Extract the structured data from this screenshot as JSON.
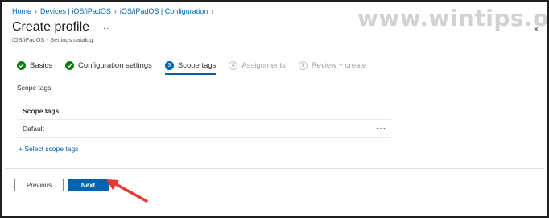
{
  "breadcrumb": {
    "items": [
      "Home",
      "Devices | iOS/iPadOS",
      "iOS/iPadOS | Configuration"
    ]
  },
  "header": {
    "title": "Create profile",
    "more_label": "...",
    "subtitle": "iOS/iPadOS - Settings catalog",
    "close_label": "×"
  },
  "watermark": {
    "text": "www.wintips.org"
  },
  "wizard": {
    "steps": [
      {
        "label": "Basics",
        "state": "done",
        "marker": "✓"
      },
      {
        "label": "Configuration settings",
        "state": "done",
        "marker": "✓"
      },
      {
        "label": "Scope tags",
        "state": "active",
        "marker": "3"
      },
      {
        "label": "Assignments",
        "state": "disabled",
        "marker": "4"
      },
      {
        "label": "Review + create",
        "state": "disabled",
        "marker": "5"
      }
    ]
  },
  "main": {
    "section_label": "Scope tags",
    "table": {
      "header": "Scope tags",
      "rows": [
        {
          "name": "Default",
          "more_label": "···"
        }
      ]
    },
    "select_link": "+ Select scope tags"
  },
  "footer": {
    "previous_label": "Previous",
    "next_label": "Next"
  },
  "colors": {
    "accent": "#0063b1",
    "success": "#107c10",
    "annotation_arrow": "#e53935"
  }
}
